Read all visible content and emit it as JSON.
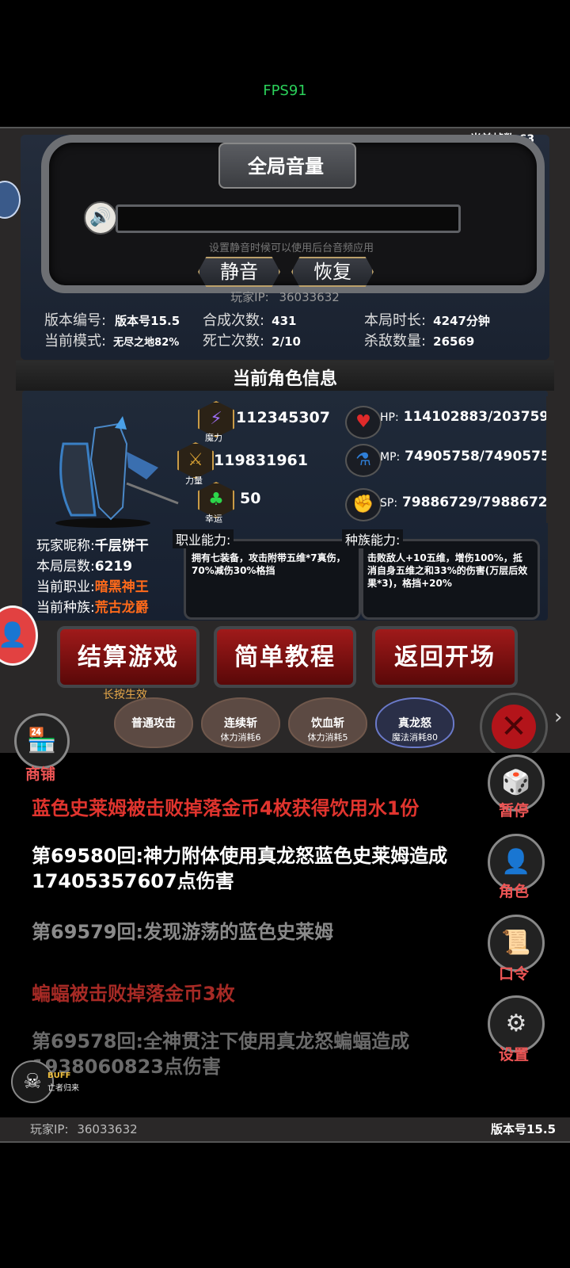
{
  "status_bar": {
    "fps": "FPS91"
  },
  "frame_counter": "当前帧数:63",
  "volume": {
    "title": "全局音量",
    "hint": "设置静音时候可以使用后台音频应用",
    "mute_label": "静音",
    "restore_label": "恢复",
    "level": 0
  },
  "player_ip_label": "玩家IP:",
  "player_ip": "36033632",
  "stats": {
    "version_label": "版本编号:",
    "version_value": "版本号15.5",
    "compose_label": "合成次数:",
    "compose_value": "431",
    "duration_label": "本局时长:",
    "duration_value": "4247分钟",
    "mode_label": "当前模式:",
    "mode_value": "无尽之地82%",
    "death_label": "死亡次数:",
    "death_value": "2/10",
    "kills_label": "杀敌数量:",
    "kills_value": "26569"
  },
  "role": {
    "section_title": "当前角色信息",
    "magic_value": "112345307",
    "magic_caption": "魔力",
    "power_value": "119831961",
    "power_caption": "力量",
    "luck_value": "50",
    "luck_caption": "幸运",
    "hp_label": "HP:",
    "hp_value": "114102883/203759",
    "mp_label": "MP:",
    "mp_value": "74905758/7490575",
    "sp_label": "SP:",
    "sp_value": "79886729/7988672",
    "nickname_label": "玩家昵称:",
    "nickname_value": "千层饼干",
    "floor_label": "本局层数:",
    "floor_value": "6219",
    "class_label": "当前职业:",
    "class_value": "暗黑神王",
    "race_label": "当前种族:",
    "race_value": "荒古龙爵",
    "class_ability_tag": "职业能力:",
    "class_ability_text": "拥有七装备，攻击附带五维*7真伤，70%减伤30%格挡",
    "race_ability_tag": "种族能力:",
    "race_ability_text": "击败敌人+10五维，增伤100%，抵消自身五维之和33%的伤害(万层后效果*3)，格挡+20%"
  },
  "buttons": {
    "settle": "结算游戏",
    "settle_hint": "长按生效",
    "tutorial": "简单教程",
    "return": "返回开场"
  },
  "skills": [
    {
      "name": "普通攻击",
      "cost": ""
    },
    {
      "name": "连续斩",
      "cost": "体力消耗6"
    },
    {
      "name": "饮血斩",
      "cost": "体力消耗5"
    },
    {
      "name": "真龙怒",
      "cost": "魔法消耗80"
    }
  ],
  "shop_label": "商铺",
  "side_menu": {
    "pause": "暂停",
    "role": "角色",
    "command": "口令",
    "settings": "设置"
  },
  "log": [
    {
      "text": "蓝色史莱姆被击败掉落金币4枚获得饮用水1份",
      "color": "#e0342e"
    },
    {
      "text": "第69580回:神力附体使用真龙怒蓝色史莱姆造成17405357607点伤害",
      "color": "#ffffff"
    },
    {
      "text": "第69579回:发现游荡的蓝色史莱姆",
      "color": "#8a8a8a"
    },
    {
      "text": "蝙蝠被击败掉落金币3枚",
      "color": "#a62a25"
    },
    {
      "text": "第69578回:全神贯注下使用真龙怒蝙蝠造成1938060823点伤害",
      "color": "#6a6a6a"
    }
  ],
  "buff": {
    "label": "BUFF",
    "name": "亡者归来"
  },
  "footer": {
    "ip_label": "玩家IP:",
    "ip": "36033632",
    "version": "版本号15.5"
  }
}
